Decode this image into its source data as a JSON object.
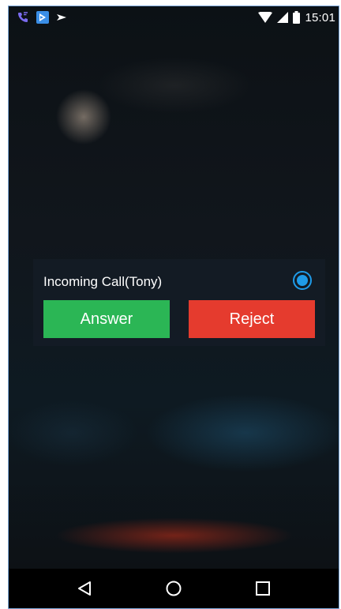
{
  "status_bar": {
    "time": "15:01",
    "left_icons": [
      "phone-call-icon",
      "screencast-app-icon",
      "send-notification-icon"
    ],
    "right_icons": [
      "wifi-icon",
      "signal-icon",
      "battery-icon"
    ]
  },
  "incoming_call": {
    "title": "Incoming Call(Tony)",
    "answer_label": "Answer",
    "reject_label": "Reject",
    "answer_color": "#2bb655",
    "reject_color": "#e53b2e",
    "radio_selected": true,
    "accent_color": "#1f9be8"
  },
  "nav_bar": {
    "buttons": [
      "back-icon",
      "home-icon",
      "recents-icon"
    ]
  }
}
